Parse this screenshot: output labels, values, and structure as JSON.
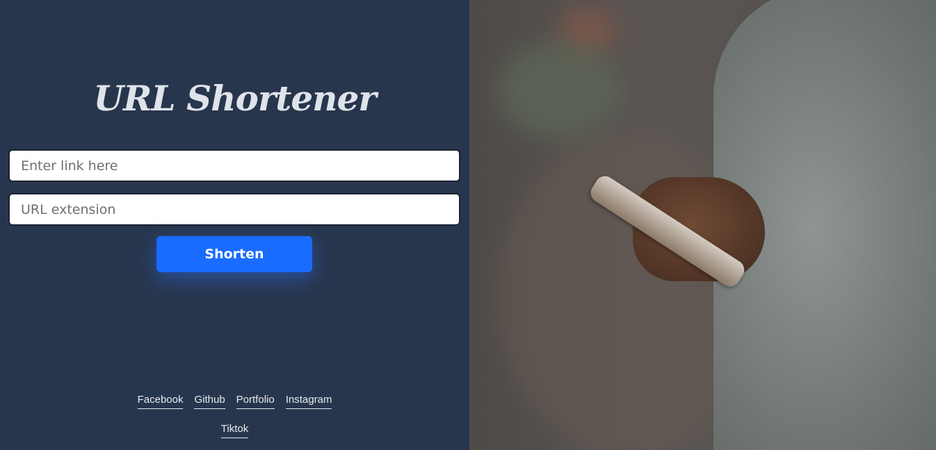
{
  "app": {
    "title": "URL Shortener"
  },
  "form": {
    "link_placeholder": "Enter link here",
    "link_value": "",
    "extension_placeholder": "URL extension",
    "extension_value": "",
    "submit_label": "Shorten"
  },
  "footer": {
    "links": [
      "Facebook",
      "Github",
      "Portfolio",
      "Instagram",
      "Tiktok"
    ]
  },
  "colors": {
    "panel_background": "#28364d",
    "accent": "#1a6bff"
  },
  "icons": {
    "hero_image": "person-holding-phone-photo"
  }
}
